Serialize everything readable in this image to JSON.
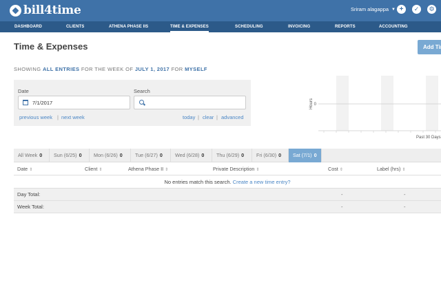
{
  "brand": {
    "name": "bill4time"
  },
  "user": {
    "name": "Sriram alagappa"
  },
  "nav": [
    {
      "label": "DASHBOARD"
    },
    {
      "label": "CLIENTS"
    },
    {
      "label": "ATHENA PHASE IIS"
    },
    {
      "label": "TIME & EXPENSES"
    },
    {
      "label": "SCHEDULING"
    },
    {
      "label": "INVOICING"
    },
    {
      "label": "REPORTS"
    },
    {
      "label": "ACCOUNTING"
    }
  ],
  "page": {
    "title": "Time & Expenses",
    "add_button": "Add Time"
  },
  "showing": {
    "prefix": "SHOWING",
    "entries": "ALL ENTRIES",
    "mid": "FOR THE WEEK OF",
    "date": "JULY 1, 2017",
    "for": "FOR",
    "who": "MYSELF"
  },
  "filter": {
    "date_label": "Date",
    "date_value": "7/1/2017",
    "search_label": "Search",
    "search_value": "",
    "prev_week": "previous week",
    "next_week": "next week",
    "today": "today",
    "clear": "clear",
    "advanced": "advanced",
    "sep": "|"
  },
  "chart": {
    "ylabel": "Hours",
    "zero_tick": "0",
    "xlabel": "Past 30 Days"
  },
  "tabs": [
    {
      "label": "All Week",
      "count": "0"
    },
    {
      "label": "Sun (6/25)",
      "count": "0"
    },
    {
      "label": "Mon (6/26)",
      "count": "0"
    },
    {
      "label": "Tue (6/27)",
      "count": "0"
    },
    {
      "label": "Wed (6/28)",
      "count": "0"
    },
    {
      "label": "Thu (6/29)",
      "count": "0"
    },
    {
      "label": "Fri (6/30)",
      "count": "0"
    },
    {
      "label": "Sat (7/1)",
      "count": "0"
    }
  ],
  "table": {
    "headers": [
      "Date",
      "Client",
      "Athena Phase II",
      "Private Description",
      "Cost",
      "Label (hrs)"
    ],
    "sort_icon": "⇕",
    "empty_text": "No entries match this search.",
    "empty_link": "Create a new time entry?",
    "day_total_label": "Day Total:",
    "week_total_label": "Week Total:",
    "dash": "-"
  },
  "colors": {
    "topbar": "#3f72a8",
    "nav": "#2c5a89",
    "accent": "#79a9d3",
    "link": "#4a86c5"
  }
}
